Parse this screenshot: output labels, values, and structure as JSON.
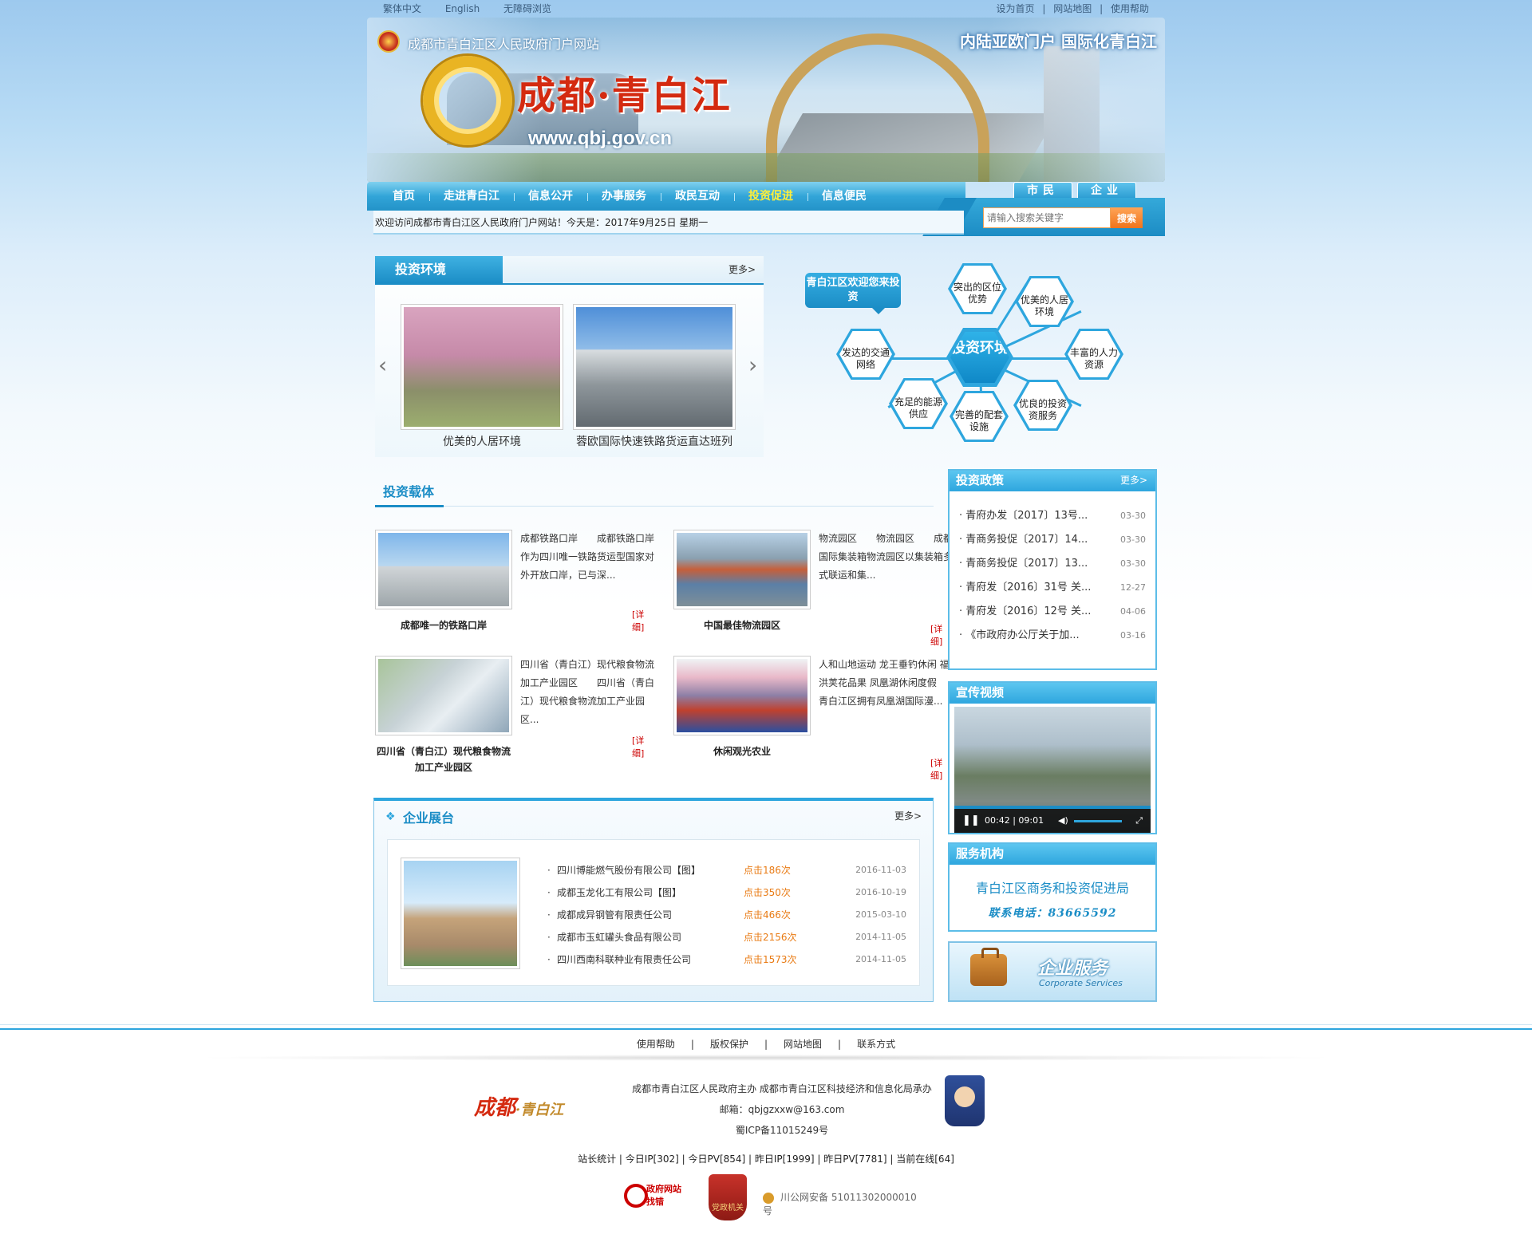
{
  "topbar": {
    "links_left": [
      "繁体中文",
      "English",
      "无障碍浏览"
    ],
    "links_right": [
      "设为首页",
      "网站地图",
      "使用帮助"
    ],
    "sep": "|"
  },
  "banner": {
    "site_name": "成都市青白江区人民政府门户网站",
    "slogan": "内陆亚欧门户  国际化青白江",
    "logo_text": "成都·青白江",
    "logo_url": "www.qbj.gov.cn"
  },
  "nav": {
    "items": [
      "首页",
      "走进青白江",
      "信息公开",
      "办事服务",
      "政民互动",
      "投资促进",
      "信息便民"
    ],
    "active": "投资促进"
  },
  "user_tabs": [
    "市民",
    "企业"
  ],
  "welcome": "欢迎访问成都市青白江区人民政府门户网站！今天是：2017年9月25日  星期一",
  "search": {
    "placeholder": "请输入搜索关键字",
    "button": "搜索"
  },
  "env": {
    "title": "投资环境",
    "more": "更多>",
    "prev": "‹",
    "next": "›",
    "photos": [
      {
        "caption": "优美的人居环境"
      },
      {
        "caption": "蓉欧国际快速铁路货运直达班列"
      }
    ]
  },
  "diagram": {
    "bubble": "青白江区欢迎您来投资",
    "center": "投资环境",
    "nodes": [
      {
        "label": "突出的区位优势",
        "icon": "location-icon"
      },
      {
        "label": "优美的人居环境",
        "icon": "tree-icon"
      },
      {
        "label": "丰富的人力资源",
        "icon": "people-icon"
      },
      {
        "label": "优良的投资资服务",
        "icon": "bar-chart-icon"
      },
      {
        "label": "完善的配套设施",
        "icon": "target-icon"
      },
      {
        "label": "充足的能源供应",
        "icon": "fan-icon"
      },
      {
        "label": "发达的交通网络",
        "icon": "trend-icon"
      }
    ]
  },
  "carrier": {
    "title": "投资载体",
    "detail": "[详细]",
    "items": [
      {
        "caption": "成都唯一的铁路口岸",
        "desc": "成都铁路口岸　　成都铁路口岸作为四川唯一铁路货运型国家对外开放口岸，已与深..."
      },
      {
        "caption": "中国最佳物流园区",
        "desc": "物流园区　　物流园区　　成都国际集装箱物流园区以集装箱多式联运和集..."
      },
      {
        "caption": "四川省（青白江）现代粮食物流加工产业园区",
        "desc": "四川省（青白江）现代粮食物流加工产业园区　　四川省（青白江）现代粮食物流加工产业园区..."
      },
      {
        "caption": "休闲观光农业",
        "desc": "人和山地运动 龙王垂钓休闲 福洪荚花品果 凤凰湖休闲度假　　青白江区拥有凤凰湖国际漫..."
      }
    ]
  },
  "enterprise": {
    "title": "企业展台",
    "more": "更多>",
    "items": [
      {
        "name": "四川博能燃气股份有限公司【图】",
        "hits": "点击186次",
        "date": "2016-11-03"
      },
      {
        "name": "成都玉龙化工有限公司【图】",
        "hits": "点击350次",
        "date": "2016-10-19"
      },
      {
        "name": "成都成异钢管有限责任公司",
        "hits": "点击466次",
        "date": "2015-03-10"
      },
      {
        "name": "成都市玉虹罐头食品有限公司",
        "hits": "点击2156次",
        "date": "2014-11-05"
      },
      {
        "name": "四川西南科联种业有限责任公司",
        "hits": "点击1573次",
        "date": "2014-11-05"
      }
    ]
  },
  "policy": {
    "title": "投资政策",
    "more": "更多>",
    "items": [
      {
        "title": "青府办发〔2017〕13号...",
        "date": "03-30"
      },
      {
        "title": "青商务投促〔2017〕14...",
        "date": "03-30"
      },
      {
        "title": "青商务投促〔2017〕13...",
        "date": "03-30"
      },
      {
        "title": "青府发〔2016〕31号 关...",
        "date": "12-27"
      },
      {
        "title": "青府发〔2016〕12号 关...",
        "date": "04-06"
      },
      {
        "title": "《市政府办公厅关于加...",
        "date": "03-16"
      }
    ]
  },
  "video": {
    "title": "宣传视频",
    "time": "00:42 | 09:01"
  },
  "org": {
    "title": "服务机构",
    "name": "青白江区商务和投资促进局",
    "phone": "联系电话：83665592"
  },
  "service": {
    "cn": "企业服务",
    "en": "Corporate Services"
  },
  "footer": {
    "links": [
      "使用帮助",
      "版权保护",
      "网站地图",
      "联系方式"
    ],
    "logo_main": "成都",
    "logo_dot": "·",
    "logo_sub": "青白江",
    "host": "成都市青白江区人民政府主办 成都市青白江区科技经济和信息化局承办",
    "email": "邮箱：qbjgzxxw@163.com",
    "icp": "蜀ICP备11015249号",
    "stats": "站长统计 | 今日IP[302] | 今日PV[854] | 昨日IP[1999] | 昨日PV[7781] | 当前在线[64]",
    "badge1": "政府网站 找错",
    "badge2": "党政机关",
    "police_reg": "川公网安备 51011302000010号"
  }
}
